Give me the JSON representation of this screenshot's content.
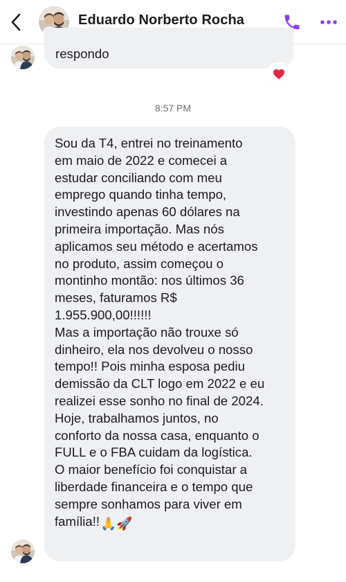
{
  "header": {
    "contact_name": "Eduardo Norberto Rocha",
    "back_icon": "chevron-left-icon",
    "call_icon": "phone-icon",
    "more_icon": "more-horizontal-icon",
    "accent_color": "#8a3ffc"
  },
  "messages": {
    "previous": {
      "text": "respondo",
      "reaction": "❤️"
    },
    "timestamp": "8:57 PM",
    "main": {
      "text": "Sou da T4, entrei no treinamento\nem maio de 2022 e comecei a\nestudar conciliando com meu\nemprego quando tinha tempo,\ninvestindo apenas 60 dólares na\nprimeira importação. Mas nós\naplicamos seu método e acertamos\nno produto, assim começou o\nmontinho montão: nos últimos 36\nmeses, faturamos R$\n1.955.900,00!!!!!!\nMas a importação não trouxe só\ndinheiro, ela nos devolveu o nosso\ntempo!! Pois minha esposa pediu\ndemissão da CLT logo em 2022 e eu\nrealizei esse sonho no final de 2024.\nHoje, trabalhamos juntos, no\nconforto da nossa casa, enquanto o\nFULL e o FBA cuidam da logística.\nO maior benefício foi conquistar a\nliberdade financeira e o tempo que\nsempre sonhamos para viver em\nfamília!!",
      "emojis": "🙏🚀"
    }
  },
  "colors": {
    "bubble": "#eff0f2",
    "reaction_heart": "#e0283e",
    "timestamp": "#6e6e73"
  }
}
